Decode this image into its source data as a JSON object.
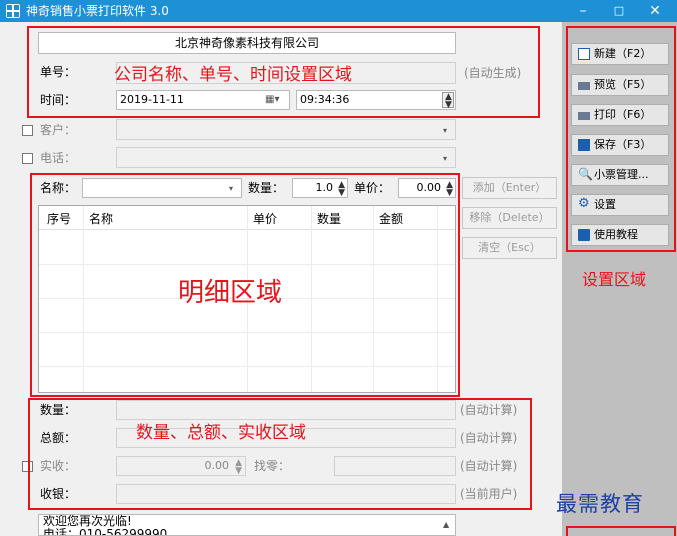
{
  "window": {
    "title": "神奇销售小票打印软件 3.0"
  },
  "company": {
    "name": "北京神奇像素科技有限公司"
  },
  "order": {
    "label": "单号：",
    "auto": "(自动生成)"
  },
  "time": {
    "label": "时间：",
    "date": "2019-11-11",
    "clock": "09:34:36"
  },
  "customer": {
    "label": "客户："
  },
  "phone": {
    "label": "电话："
  },
  "item": {
    "name_label": "名称：",
    "qty_label": "数量：",
    "qty_value": "1.0",
    "price_label": "单价：",
    "price_value": "0.00"
  },
  "item_buttons": {
    "add": "添加（Enter）",
    "remove": "移除（Delete）",
    "clear": "清空（Esc）"
  },
  "table": {
    "columns": [
      "序号",
      "名称",
      "单价",
      "数量",
      "金额"
    ]
  },
  "totals": {
    "qty_label": "数量：",
    "qty_auto": "(自动计算)",
    "amount_label": "总额：",
    "amount_auto": "(自动计算)",
    "received_label": "实收：",
    "received_value": "0.00",
    "change_label": "找零：",
    "received_auto": "(自动计算)",
    "cashier_label": "收银：",
    "cashier_auto": "(当前用户)"
  },
  "footer": {
    "line1": "欢迎您再次光临!",
    "line2": "电话：010-56299990"
  },
  "sidebar": {
    "new": "新建（F2）",
    "preview": "预览（F5）",
    "print": "打印（F6）",
    "save": "保存（F3）",
    "manage": "小票管理...",
    "settings": "设置",
    "tutorial": "使用教程"
  },
  "annotations": {
    "header_zone": "公司名称、单号、时间设置区域",
    "detail_zone": "明细区域",
    "totals_zone": "数量、总额、实收区域",
    "settings_zone": "设置区域",
    "watermark": "最需教育"
  },
  "colors": {
    "titlebar": "#1e90d6",
    "annotation": "#e5141c",
    "sidebar": "#bfbfbf"
  }
}
